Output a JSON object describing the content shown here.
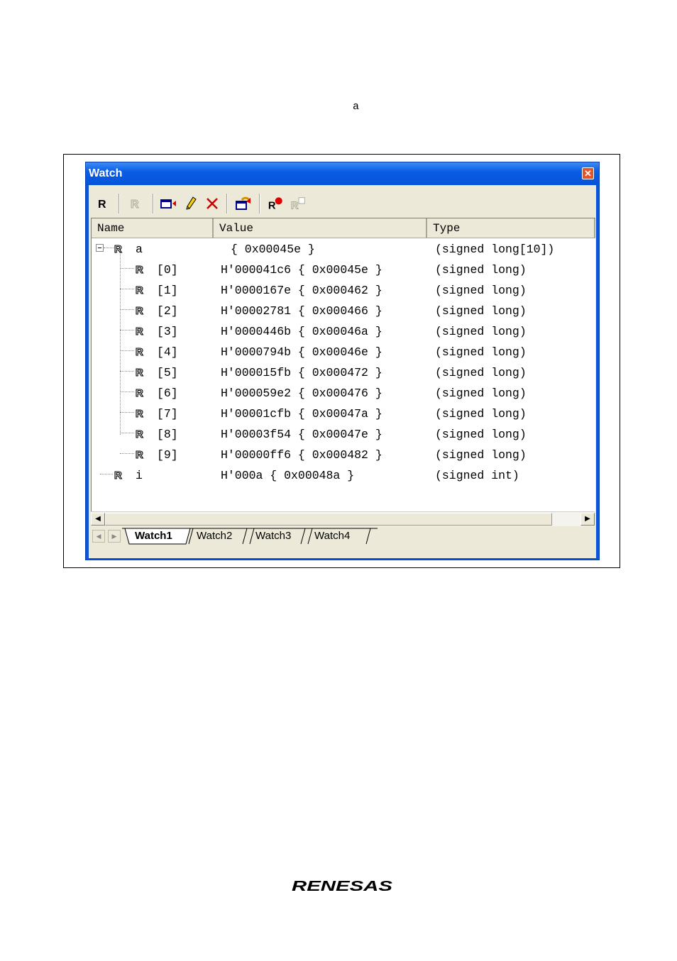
{
  "caption": "a",
  "window": {
    "title": "Watch",
    "close_glyph": "✕"
  },
  "toolbar": {
    "items": [
      {
        "icon": "register-icon",
        "enabled": true
      },
      {
        "icon": "register-disabled-icon",
        "enabled": false
      },
      {
        "icon": "add-watch-icon",
        "enabled": true
      },
      {
        "icon": "edit-pencil-icon",
        "enabled": true
      },
      {
        "icon": "delete-icon",
        "enabled": true
      },
      {
        "icon": "refresh-icon",
        "enabled": true
      },
      {
        "icon": "register-breakpoint-icon",
        "enabled": true
      },
      {
        "icon": "register-copy-disabled-icon",
        "enabled": false
      }
    ]
  },
  "columns": {
    "name": "Name",
    "value": "Value",
    "type": "Type"
  },
  "rows": [
    {
      "name": "a",
      "value": "{ 0x00045e }",
      "type": "(signed long[10])"
    },
    {
      "name": "[0]",
      "value": "H'000041c6 { 0x00045e }",
      "type": "(signed long)"
    },
    {
      "name": "[1]",
      "value": "H'0000167e { 0x000462 }",
      "type": "(signed long)"
    },
    {
      "name": "[2]",
      "value": "H'00002781 { 0x000466 }",
      "type": "(signed long)"
    },
    {
      "name": "[3]",
      "value": "H'0000446b { 0x00046a }",
      "type": "(signed long)"
    },
    {
      "name": "[4]",
      "value": "H'0000794b { 0x00046e }",
      "type": "(signed long)"
    },
    {
      "name": "[5]",
      "value": "H'000015fb { 0x000472 }",
      "type": "(signed long)"
    },
    {
      "name": "[6]",
      "value": "H'000059e2 { 0x000476 }",
      "type": "(signed long)"
    },
    {
      "name": "[7]",
      "value": "H'00001cfb { 0x00047a }",
      "type": "(signed long)"
    },
    {
      "name": "[8]",
      "value": "H'00003f54 { 0x00047e }",
      "type": "(signed long)"
    },
    {
      "name": "[9]",
      "value": "H'00000ff6 { 0x000482 }",
      "type": "(signed long)"
    },
    {
      "name": "i",
      "value": "H'000a { 0x00048a }",
      "type": "(signed int)"
    }
  ],
  "tabs": [
    "Watch1",
    "Watch2",
    "Watch3",
    "Watch4"
  ],
  "active_tab": "Watch1",
  "logo_text": "RENESAS"
}
